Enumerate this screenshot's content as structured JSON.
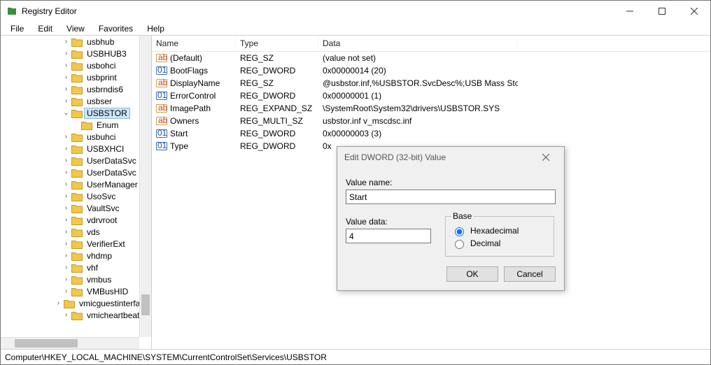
{
  "window": {
    "title": "Registry Editor"
  },
  "menu": {
    "file": "File",
    "edit": "Edit",
    "view": "View",
    "favorites": "Favorites",
    "help": "Help"
  },
  "list": {
    "headers": {
      "name": "Name",
      "type": "Type",
      "data": "Data"
    },
    "rows": [
      {
        "icon": "ab",
        "name": "(Default)",
        "type": "REG_SZ",
        "data": "(value not set)"
      },
      {
        "icon": "dw",
        "name": "BootFlags",
        "type": "REG_DWORD",
        "data": "0x00000014 (20)"
      },
      {
        "icon": "ab",
        "name": "DisplayName",
        "type": "REG_SZ",
        "data": "@usbstor.inf,%USBSTOR.SvcDesc%;USB Mass Stor..."
      },
      {
        "icon": "dw",
        "name": "ErrorControl",
        "type": "REG_DWORD",
        "data": "0x00000001 (1)"
      },
      {
        "icon": "ab",
        "name": "ImagePath",
        "type": "REG_EXPAND_SZ",
        "data": "\\SystemRoot\\System32\\drivers\\USBSTOR.SYS"
      },
      {
        "icon": "ab",
        "name": "Owners",
        "type": "REG_MULTI_SZ",
        "data": "usbstor.inf v_mscdsc.inf"
      },
      {
        "icon": "dw",
        "name": "Start",
        "type": "REG_DWORD",
        "data": "0x00000003 (3)"
      },
      {
        "icon": "dw",
        "name": "Type",
        "type": "REG_DWORD",
        "data": "0x"
      }
    ]
  },
  "tree": {
    "items": [
      {
        "depth": 6,
        "chev": ">",
        "label": "usbhub"
      },
      {
        "depth": 6,
        "chev": ">",
        "label": "USBHUB3"
      },
      {
        "depth": 6,
        "chev": ">",
        "label": "usbohci"
      },
      {
        "depth": 6,
        "chev": ">",
        "label": "usbprint"
      },
      {
        "depth": 6,
        "chev": ">",
        "label": "usbrndis6"
      },
      {
        "depth": 6,
        "chev": ">",
        "label": "usbser"
      },
      {
        "depth": 6,
        "chev": "v",
        "label": "USBSTOR",
        "selected": true
      },
      {
        "depth": 7,
        "chev": "",
        "label": "Enum"
      },
      {
        "depth": 6,
        "chev": ">",
        "label": "usbuhci"
      },
      {
        "depth": 6,
        "chev": ">",
        "label": "USBXHCI"
      },
      {
        "depth": 6,
        "chev": ">",
        "label": "UserDataSvc"
      },
      {
        "depth": 6,
        "chev": ">",
        "label": "UserDataSvc"
      },
      {
        "depth": 6,
        "chev": ">",
        "label": "UserManager"
      },
      {
        "depth": 6,
        "chev": ">",
        "label": "UsoSvc"
      },
      {
        "depth": 6,
        "chev": ">",
        "label": "VaultSvc"
      },
      {
        "depth": 6,
        "chev": ">",
        "label": "vdrvroot"
      },
      {
        "depth": 6,
        "chev": ">",
        "label": "vds"
      },
      {
        "depth": 6,
        "chev": ">",
        "label": "VerifierExt"
      },
      {
        "depth": 6,
        "chev": ">",
        "label": "vhdmp"
      },
      {
        "depth": 6,
        "chev": ">",
        "label": "vhf"
      },
      {
        "depth": 6,
        "chev": ">",
        "label": "vmbus"
      },
      {
        "depth": 6,
        "chev": ">",
        "label": "VMBusHID"
      },
      {
        "depth": 6,
        "chev": ">",
        "label": "vmicguestinterface"
      },
      {
        "depth": 6,
        "chev": ">",
        "label": "vmicheartbeat"
      }
    ]
  },
  "status": {
    "path": "Computer\\HKEY_LOCAL_MACHINE\\SYSTEM\\CurrentControlSet\\Services\\USBSTOR"
  },
  "dialog": {
    "title": "Edit DWORD (32-bit) Value",
    "value_name_label": "Value name:",
    "value_name": "Start",
    "value_data_label": "Value data:",
    "value_data": "4",
    "base_label": "Base",
    "hex_label": "Hexadecimal",
    "dec_label": "Decimal",
    "ok": "OK",
    "cancel": "Cancel"
  }
}
